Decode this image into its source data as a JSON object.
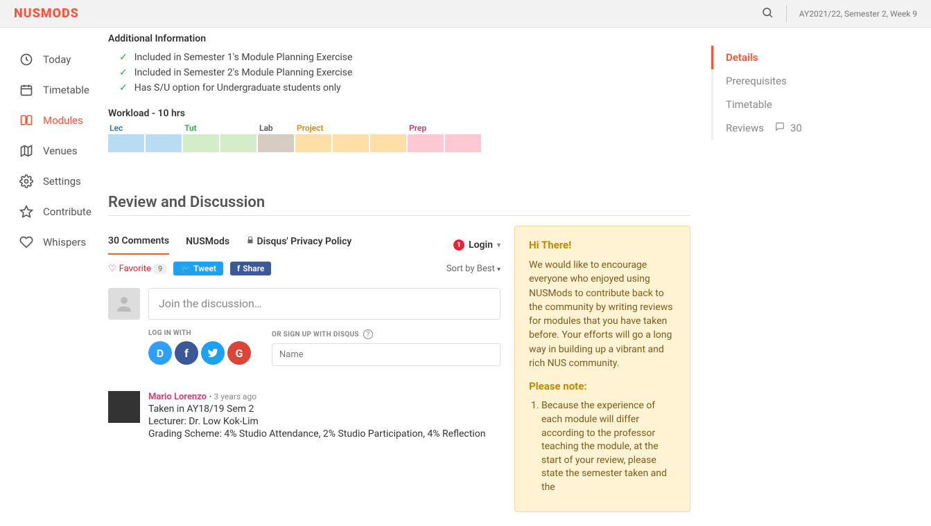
{
  "topbar": {
    "logo": "NUSMODS",
    "period": "AY2021/22, Semester 2, Week 9"
  },
  "sidebar": {
    "items": [
      {
        "label": "Today"
      },
      {
        "label": "Timetable"
      },
      {
        "label": "Modules"
      },
      {
        "label": "Venues"
      },
      {
        "label": "Settings"
      },
      {
        "label": "Contribute"
      },
      {
        "label": "Whispers"
      }
    ]
  },
  "rightnav": {
    "items": [
      {
        "label": "Details"
      },
      {
        "label": "Prerequisites"
      },
      {
        "label": "Timetable"
      },
      {
        "label": "Reviews",
        "count": "30"
      }
    ]
  },
  "addinfo": {
    "heading": "Additional Information",
    "lines": [
      "Included in Semester 1's Module Planning Exercise",
      "Included in Semester 2's Module Planning Exercise",
      "Has S/U option for Undergraduate students only"
    ]
  },
  "workload": {
    "heading": "Workload - 10 hrs",
    "groups": [
      {
        "label": "Lec",
        "count": 2
      },
      {
        "label": "Tut",
        "count": 2
      },
      {
        "label": "Lab",
        "count": 1
      },
      {
        "label": "Project",
        "count": 3
      },
      {
        "label": "Prep",
        "count": 2
      }
    ]
  },
  "review": {
    "heading": "Review and Discussion",
    "comments_tab": "30 Comments",
    "brand_tab": "NUSMods",
    "privacy_tab": "Disqus' Privacy Policy",
    "login_label": "Login",
    "login_count": "1",
    "favorite_label": "Favorite",
    "favorite_count": "9",
    "tweet_label": "Tweet",
    "share_label": "Share",
    "sort_label": "Sort by Best",
    "join_placeholder": "Join the discussion…",
    "login_with": "LOG IN WITH",
    "signup_with": "OR SIGN UP WITH DISQUS",
    "name_placeholder": "Name"
  },
  "comment1": {
    "author": "Mario Lorenzo",
    "time": "3 years ago",
    "line1": "Taken in AY18/19 Sem 2",
    "line2": "Lecturer: Dr. Low Kok-Lim",
    "line3": "Grading Scheme: 4% Studio Attendance, 2% Studio Participation, 4% Reflection"
  },
  "notice": {
    "h1": "Hi There!",
    "p1": "We would like to encourage everyone who enjoyed using NUSMods to contribute back to the community by writing reviews for modules that you have taken before. Your efforts will go a long way in building up a vibrant and rich NUS community.",
    "h2": "Please note:",
    "li1": "Because the experience of each module will differ according to the professor teaching the module, at the start of your review, please state the semester taken and the"
  }
}
